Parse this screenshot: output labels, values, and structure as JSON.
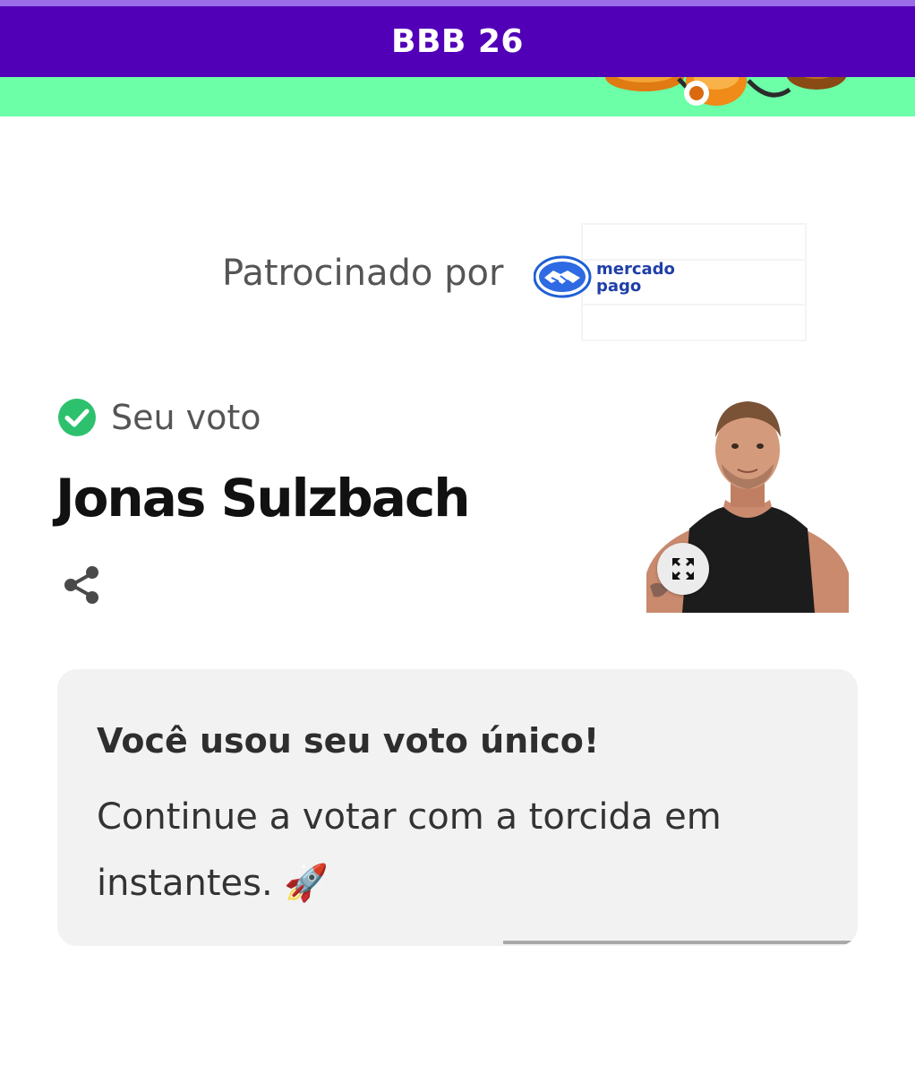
{
  "header": {
    "title": "BBB 26"
  },
  "colors": {
    "header_bg": "#5200b8",
    "banner_bg": "#6cffa8",
    "check_green": "#2ec16d"
  },
  "sponsor": {
    "label": "Patrocinado por",
    "logo_text_line1": "mercado",
    "logo_text_line2": "pago"
  },
  "vote": {
    "status_label": "Seu voto",
    "candidate_name": "Jonas Sulzbach"
  },
  "icons": {
    "status": "check-circle-icon",
    "share": "share-icon",
    "expand": "expand-icon"
  },
  "notice": {
    "title": "Você usou seu voto único!",
    "body": "Continue a votar com a torcida em instantes. 🚀"
  }
}
